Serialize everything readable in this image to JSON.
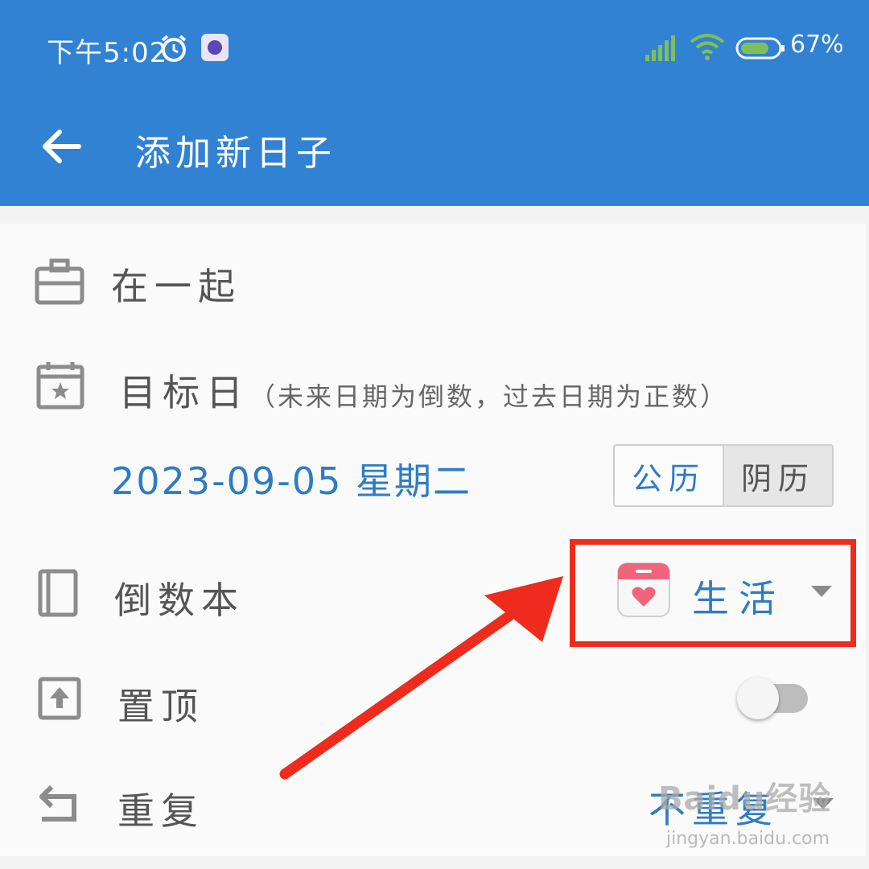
{
  "status_bar": {
    "time": "下午5:02",
    "battery_percent": "67%",
    "icons": [
      "alarm-icon",
      "app-notification-icon",
      "signal-icon",
      "wifi-icon",
      "battery-icon"
    ]
  },
  "toolbar": {
    "back_icon": "back-arrow-icon",
    "title": "添加新日子"
  },
  "form": {
    "title_field": {
      "icon": "briefcase-icon",
      "value": "在一起"
    },
    "target_date": {
      "icon": "calendar-star-icon",
      "label": "目标日",
      "hint": "（未来日期为倒数，过去日期为正数）",
      "value": "2023-09-05 星期二",
      "calendar_options": [
        "公历",
        "阴历"
      ],
      "selected_calendar": "公历"
    },
    "countdown_book": {
      "icon": "book-icon",
      "label": "倒数本",
      "selected_icon": "calendar-heart-icon",
      "selected": "生活"
    },
    "pin_top": {
      "icon": "pin-top-icon",
      "label": "置顶",
      "enabled": false
    },
    "repeat": {
      "icon": "repeat-icon",
      "label": "重复",
      "value": "不重复"
    }
  },
  "annotation": {
    "color": "#ee2b1c"
  },
  "colors": {
    "accent": "#3182d2",
    "value_text": "#2e7cc3"
  },
  "watermark": {
    "text": "Baidu经验",
    "sub": "jingyan.baidu.com"
  }
}
